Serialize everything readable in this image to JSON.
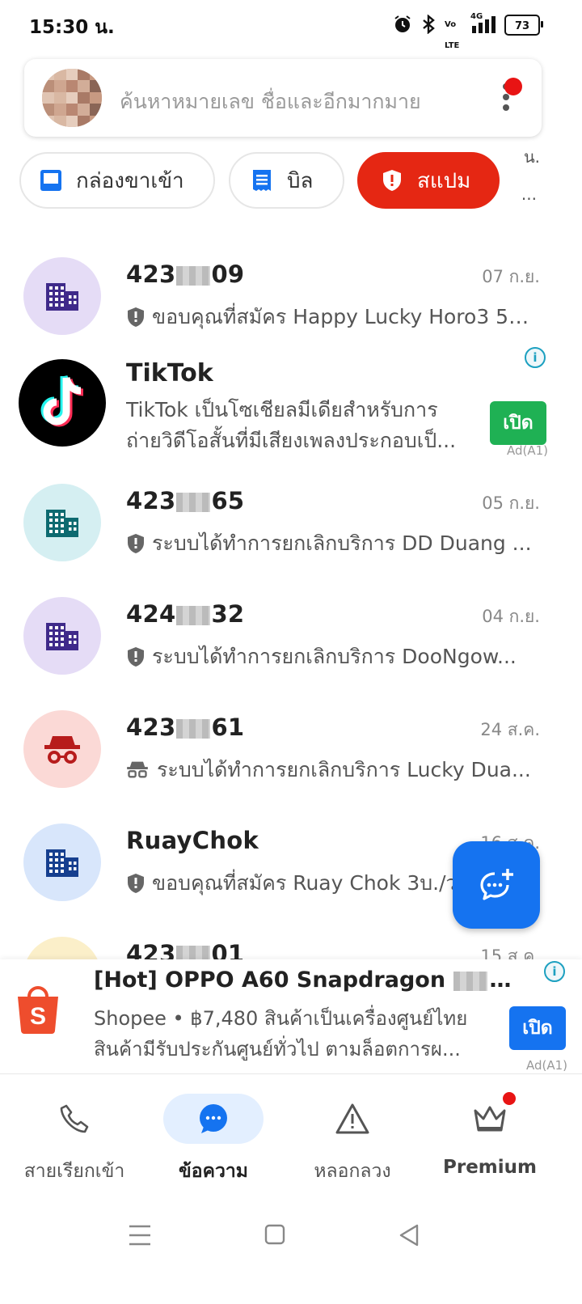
{
  "status_bar": {
    "time": "15:30 น.",
    "network": "4G",
    "volte": "Vo LTE",
    "battery": "73",
    "icons": [
      "alarm-icon",
      "bluetooth-icon",
      "volte-icon",
      "signal-icon",
      "battery-icon"
    ]
  },
  "search": {
    "placeholder": "ค้นหาหมายเลข ชื่อและอีกมากมาย"
  },
  "chips": {
    "inbox": "กล่องขาเข้า",
    "bill": "บิล",
    "spam": "สแปม",
    "faded_top": "น.",
    "faded_bottom": "..."
  },
  "messages": [
    {
      "sender_prefix": "423",
      "sender_suffix": "09",
      "date": "07 ก.ย.",
      "preview": "ขอบคุณที่สมัคร Happy Lucky Horo3 5บ...",
      "avatar_icon": "building-icon",
      "avatar_bg": "#e5dcf6",
      "icon_color": "#3f2a8a",
      "preview_icon": "shield-icon"
    },
    {
      "sender_prefix": "423",
      "sender_suffix": "65",
      "date": "05 ก.ย.",
      "preview": "ระบบได้ทำการยกเลิกบริการ DD Duang ...",
      "avatar_icon": "building-icon",
      "avatar_bg": "#d5eff2",
      "icon_color": "#0d6a70",
      "preview_icon": "shield-icon"
    },
    {
      "sender_prefix": "424",
      "sender_suffix": "32",
      "date": "04 ก.ย.",
      "preview": "ระบบได้ทำการยกเลิกบริการ DooNgow...",
      "avatar_icon": "building-icon",
      "avatar_bg": "#e5dcf6",
      "icon_color": "#3f2a8a",
      "preview_icon": "shield-icon"
    },
    {
      "sender_prefix": "423",
      "sender_suffix": "61",
      "date": "24 ส.ค.",
      "preview": "ระบบได้ทำการยกเลิกบริการ Lucky Dua...",
      "avatar_icon": "spy-icon",
      "avatar_bg": "#fbd9d6",
      "icon_color": "#b71c1c",
      "preview_icon": "spy-icon"
    },
    {
      "sender": "RuayChok",
      "date": "16 ส.ค.",
      "preview": "ขอบคุณที่สมัคร Ruay Chok 3บ./ว",
      "avatar_icon": "building-icon",
      "avatar_bg": "#d8e6fb",
      "icon_color": "#163f8f",
      "preview_icon": "shield-icon"
    },
    {
      "sender_prefix": "423",
      "sender_suffix": "01",
      "date": "15 ส.ค.",
      "preview": "",
      "avatar_icon": "building-icon",
      "avatar_bg": "#fbefc9",
      "icon_color": "#8a6d00",
      "preview_icon": "shield-icon"
    }
  ],
  "tiktok_ad": {
    "name": "TikTok",
    "desc_line1": "TikTok เป็นโซเชียลมีเดียสำหรับการ",
    "desc_line2": "ถ่ายวิดีโอสั้นที่มีเสียงเพลงประกอบเป็...",
    "button": "เปิด",
    "ad_label": "Ad(A1)",
    "info": "i",
    "button_color": "#1fb154"
  },
  "shopee_ad": {
    "title": "[Hot] OPPO A60 Snapdragon",
    "title_tail": " |...",
    "desc_line1": "Shopee • ฿7,480 สินค้าเป็นเครื่องศูนย์ไทย",
    "desc_line2": "สินค้ามีรับประกันศูนย์ทั่วไป ตามล็อตการผ...",
    "button": "เปิด",
    "ad_label": "Ad(A1)",
    "info": "i",
    "button_color": "#1573f0",
    "logo_color": "#ee4d2d"
  },
  "bottom_nav": {
    "calls": "สายเรียกเข้า",
    "messages": "ข้อความ",
    "scam": "หลอกลวง",
    "premium": "Premium"
  },
  "colors": {
    "accent": "#1573f0",
    "spam_red": "#e52713",
    "badge_red": "#e81414"
  }
}
